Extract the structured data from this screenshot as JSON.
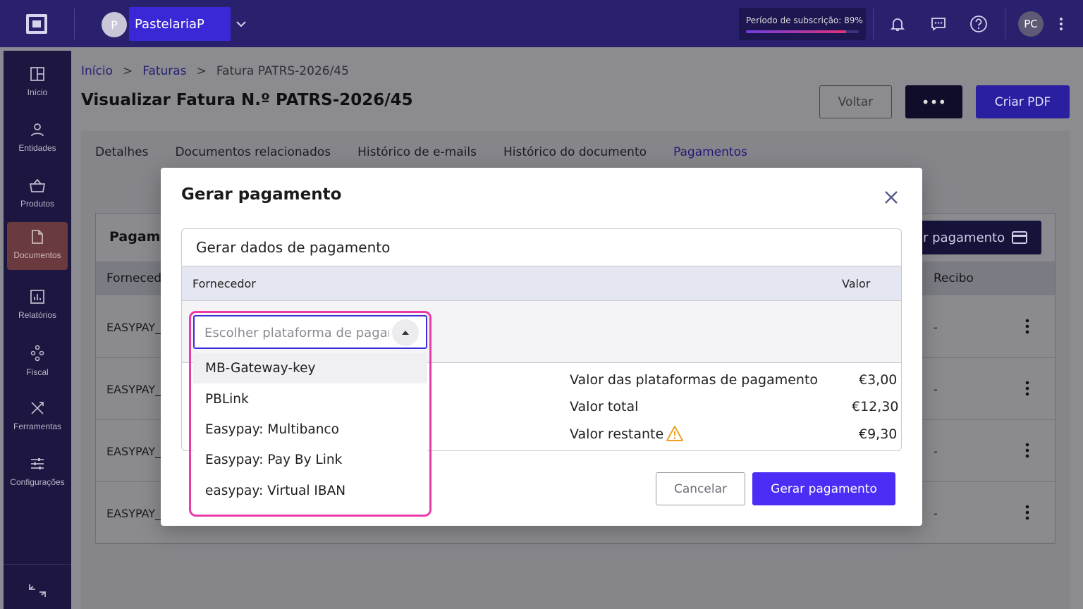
{
  "topbar": {
    "company_initial": "P",
    "company_name": "PastelariaP",
    "subscription_text": "Período de subscrição: 89%",
    "subscription_progress": 0.89,
    "user_initials": "PC"
  },
  "sidebar": {
    "items": [
      {
        "label": "Início",
        "icon": "dashboard-icon"
      },
      {
        "label": "Entidades",
        "icon": "user-icon"
      },
      {
        "label": "Produtos",
        "icon": "basket-icon"
      },
      {
        "label": "Documentos",
        "icon": "document-icon",
        "active": true
      },
      {
        "label": "Relatórios",
        "icon": "report-icon"
      },
      {
        "label": "Fiscal",
        "icon": "fiscal-icon"
      },
      {
        "label": "Ferramentas",
        "icon": "tools-icon"
      },
      {
        "label": "Configurações",
        "icon": "sliders-icon"
      }
    ]
  },
  "breadcrumb": {
    "home": "Início",
    "invoices": "Faturas",
    "current": "Fatura PATRS-2026/45",
    "separator": ">"
  },
  "page": {
    "title": "Visualizar Fatura N.º PATRS-2026/45",
    "back_label": "Voltar",
    "more_label": "•••",
    "pdf_label": "Criar PDF"
  },
  "tabs": [
    "Detalhes",
    "Documentos relacionados",
    "Histórico de e-mails",
    "Histórico do documento",
    "Pagamentos"
  ],
  "payments": {
    "title_partial": "Pagame",
    "button_partial": "r pagamento",
    "col_supplier": "Fornecedo",
    "col_receipt": "Recibo",
    "rows": [
      {
        "supplier": "EASYPAY_I",
        "receipt": "-"
      },
      {
        "supplier": "EASYPAY_V",
        "receipt": "-"
      },
      {
        "supplier": "EASYPAY_I",
        "receipt": "-"
      },
      {
        "supplier": "EASYPAY_I",
        "receipt": "-"
      }
    ]
  },
  "modal": {
    "title": "Gerar pagamento",
    "section_title": "Gerar dados de pagamento",
    "col_supplier": "Fornecedor",
    "col_value": "Valor",
    "select_placeholder": "Escolher plataforma de pagamento",
    "options": [
      "MB-Gateway-key",
      "PBLink",
      "Easypay: Multibanco",
      "Easypay: Pay By Link",
      "easypay: Virtual IBAN"
    ],
    "summary": {
      "platforms_label": "Valor das plataformas de pagamento",
      "platforms_value": "€3,00",
      "total_label": "Valor total",
      "total_value": "€12,30",
      "remaining_label": "Valor restante",
      "remaining_value": "€9,30"
    },
    "cancel_label": "Cancelar",
    "submit_label": "Gerar pagamento"
  },
  "colors": {
    "brand_primary": "#4a2ef5",
    "topbar": "#29206e",
    "highlight": "#ec3aa8",
    "warning": "#f0a020"
  }
}
